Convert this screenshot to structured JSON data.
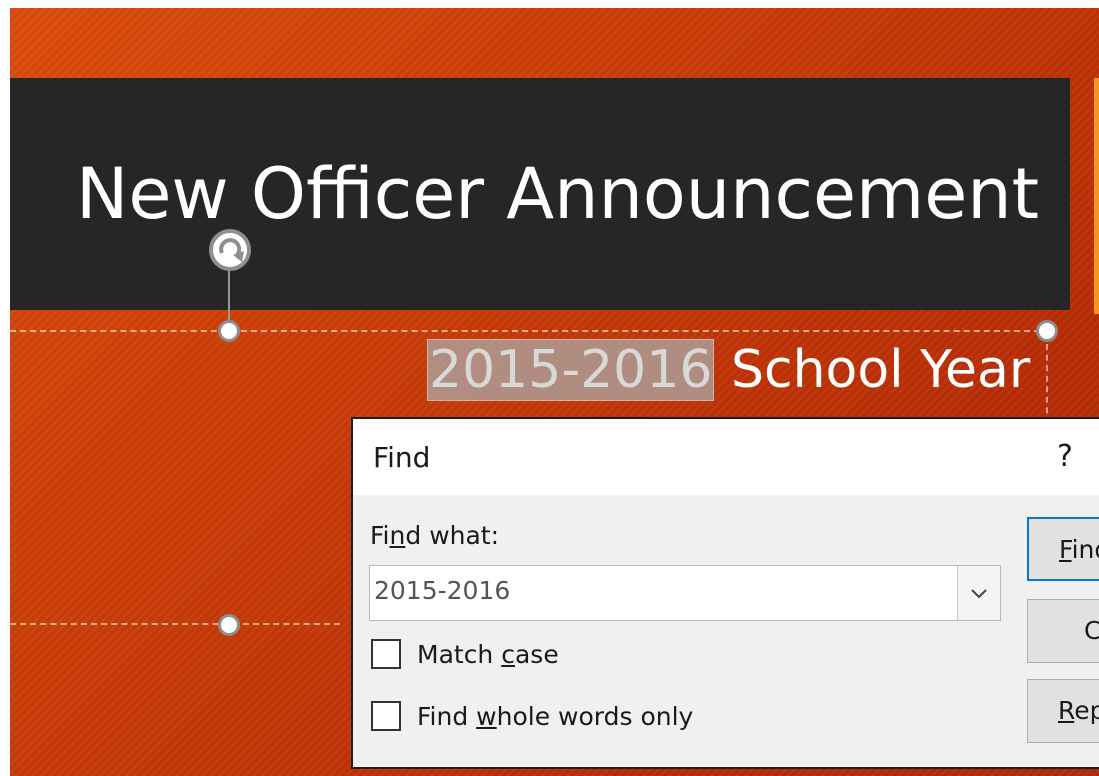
{
  "slide": {
    "title": "New Officer Announcement",
    "subtitle_highlight": "2015-2016",
    "subtitle_rest": " School Year"
  },
  "find_dialog": {
    "title": "Find",
    "help": "?",
    "find_what_label_pre": "Fi",
    "find_what_label_key": "n",
    "find_what_label_post": "d what:",
    "find_what_value": "2015-2016",
    "match_case_pre": "Match ",
    "match_case_key": "c",
    "match_case_post": "ase",
    "whole_words_pre": "Find ",
    "whole_words_key": "w",
    "whole_words_post": "hole words only",
    "buttons": {
      "find_next_key": "F",
      "find_next_rest": "ind",
      "close": "C",
      "replace_key": "R",
      "replace_rest": "ep"
    }
  },
  "colors": {
    "slide_orange": "#c53a06",
    "title_band": "#262626",
    "accent": "#f7941d",
    "focus_blue": "#0078d7"
  }
}
